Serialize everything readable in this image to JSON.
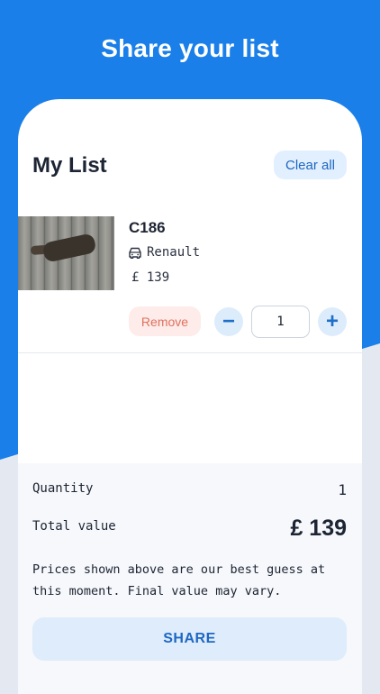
{
  "header": {
    "title": "Share your list"
  },
  "list": {
    "title": "My List",
    "clear_label": "Clear all",
    "items": [
      {
        "name": "C186",
        "make": "Renault",
        "price": "£ 139",
        "remove_label": "Remove",
        "minus_label": "−",
        "plus_label": "+",
        "quantity": "1"
      }
    ]
  },
  "summary": {
    "quantity_label": "Quantity",
    "quantity_value": "1",
    "total_label": "Total value",
    "total_value": "£ 139",
    "disclaimer": "Prices shown above are our best guess at this moment. Final value may vary.",
    "share_label": "SHARE"
  },
  "colors": {
    "accent": "#1a7fe8",
    "button_text": "#1e67c2",
    "remove_text": "#e0715c"
  }
}
